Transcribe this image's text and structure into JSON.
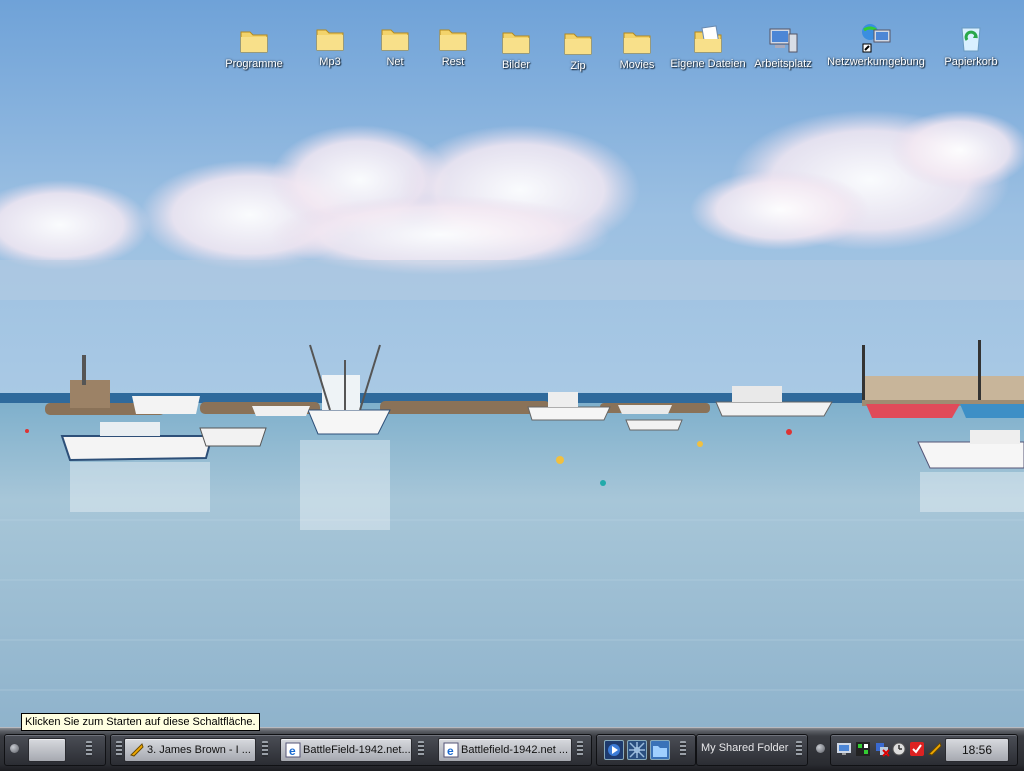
{
  "desktop": {
    "icons": [
      {
        "label": "Programme",
        "icon": "folder-icon"
      },
      {
        "label": "Mp3",
        "icon": "folder-icon"
      },
      {
        "label": "Net",
        "icon": "folder-icon"
      },
      {
        "label": "Rest",
        "icon": "folder-icon"
      },
      {
        "label": "Bilder",
        "icon": "folder-icon"
      },
      {
        "label": "Zip",
        "icon": "folder-icon"
      },
      {
        "label": "Movies",
        "icon": "folder-icon"
      },
      {
        "label": "Eigene Dateien",
        "icon": "my-documents-icon"
      },
      {
        "label": "Arbeitsplatz",
        "icon": "my-computer-icon"
      },
      {
        "label": "Netzwerkumgebung",
        "icon": "network-places-icon"
      },
      {
        "label": "Papierkorb",
        "icon": "recycle-bin-icon"
      }
    ],
    "wallpaper": "harbor-with-fishing-boats"
  },
  "tooltip": {
    "text": "Klicken Sie zum Starten auf diese Schaltfläche."
  },
  "taskbar": {
    "tasks": [
      {
        "label": "3. James Brown - I ...",
        "icon": "winamp-icon"
      },
      {
        "label": "BattleField-1942.net...",
        "icon": "internet-explorer-icon"
      },
      {
        "label": "Battlefield-1942.net ...",
        "icon": "internet-explorer-icon"
      }
    ],
    "quick_launch": [
      "media-player-icon",
      "network-icon",
      "explorer-icon"
    ],
    "shared_folder": {
      "label": "My Shared Folder"
    },
    "tray_icons": [
      "monitor-icon",
      "network-status-icon",
      "volume-mute-icon",
      "clock-icon",
      "antivirus-icon",
      "winamp-tray-icon"
    ],
    "clock": "18:56"
  },
  "colors": {
    "sky_top": "#6fa2d8",
    "sea": "#9fbfd5",
    "folder": "#f3d36b",
    "tooltip_bg": "#ffffe1"
  }
}
